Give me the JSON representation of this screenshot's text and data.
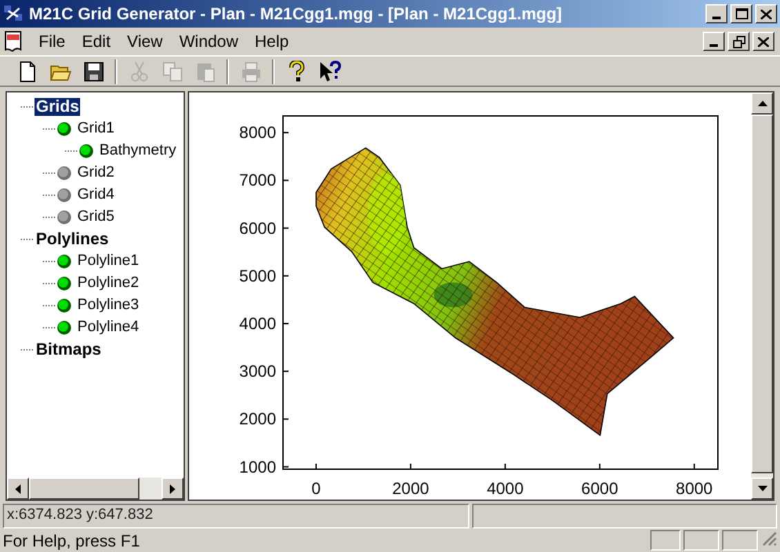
{
  "window": {
    "title": "M21C Grid Generator - Plan - M21Cgg1.mgg - [Plan - M21Cgg1.mgg]"
  },
  "menu": [
    "File",
    "Edit",
    "View",
    "Window",
    "Help"
  ],
  "toolbar": [
    {
      "kind": "new",
      "disabled": false
    },
    {
      "kind": "open",
      "disabled": false
    },
    {
      "kind": "save",
      "disabled": false
    },
    {
      "kind": "sep"
    },
    {
      "kind": "cut",
      "disabled": true
    },
    {
      "kind": "copy",
      "disabled": true
    },
    {
      "kind": "paste",
      "disabled": true
    },
    {
      "kind": "sep"
    },
    {
      "kind": "print",
      "disabled": true
    },
    {
      "kind": "sep"
    },
    {
      "kind": "help",
      "disabled": false
    },
    {
      "kind": "context_help",
      "disabled": false
    }
  ],
  "tree": [
    {
      "label": "Grids",
      "selected": true,
      "children": [
        {
          "label": "Grid1",
          "active": true,
          "selected": false,
          "children": [
            {
              "label": "Bathymetry",
              "active": true,
              "selected": false
            }
          ]
        },
        {
          "label": "Grid2",
          "active": false,
          "selected": false
        },
        {
          "label": "Grid4",
          "active": false,
          "selected": false
        },
        {
          "label": "Grid5",
          "active": false,
          "selected": false
        }
      ]
    },
    {
      "label": "Polylines",
      "selected": false,
      "children": [
        {
          "label": "Polyline1",
          "active": true,
          "selected": false
        },
        {
          "label": "Polyline2",
          "active": true,
          "selected": false
        },
        {
          "label": "Polyline3",
          "active": true,
          "selected": false
        },
        {
          "label": "Polyline4",
          "active": true,
          "selected": false
        }
      ]
    },
    {
      "label": "Bitmaps",
      "selected": false
    }
  ],
  "plot": {
    "chart_data": {
      "type": "scatter",
      "xlim": [
        -700,
        8500
      ],
      "ylim": [
        950,
        8350
      ],
      "xticks": [
        0,
        2000,
        4000,
        6000,
        8000
      ],
      "yticks": [
        1000,
        2000,
        3000,
        4000,
        5000,
        6000,
        7000,
        8000
      ]
    }
  },
  "status_bar": {
    "coordinates": "x:6374.823 y:647.832",
    "help": "For Help, press F1"
  }
}
